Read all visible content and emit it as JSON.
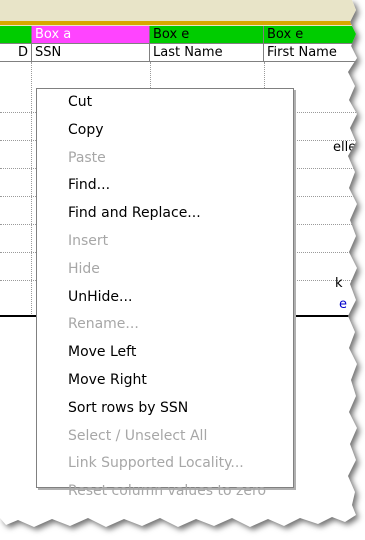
{
  "header": {
    "box_columns": [
      {
        "label": "",
        "color": "#00cc00"
      },
      {
        "label": "Box a",
        "color": "#ff44ff"
      },
      {
        "label": "Box e",
        "color": "#00cc00"
      },
      {
        "label": "Box e",
        "color": "#00cc00"
      }
    ],
    "label_columns": [
      "D",
      "SSN",
      "Last Name",
      "First Name"
    ]
  },
  "grid_peek": {
    "row3_text": "elle",
    "row8_text": "k",
    "row9_text": "e"
  },
  "context_menu": {
    "items": [
      {
        "label": "Cut",
        "enabled": true
      },
      {
        "label": "Copy",
        "enabled": true
      },
      {
        "label": "Paste",
        "enabled": false
      },
      {
        "label": "Find...",
        "enabled": true
      },
      {
        "label": "Find and Replace...",
        "enabled": true
      },
      {
        "label": "Insert",
        "enabled": false
      },
      {
        "label": "Hide",
        "enabled": false
      },
      {
        "label": "UnHide...",
        "enabled": true
      },
      {
        "label": "Rename...",
        "enabled": false
      },
      {
        "label": "Move Left",
        "enabled": true
      },
      {
        "label": "Move Right",
        "enabled": true
      },
      {
        "label": "Sort rows by SSN",
        "enabled": true
      },
      {
        "label": "Select / Unselect All",
        "enabled": false
      },
      {
        "label": "Link Supported Locality...",
        "enabled": false
      },
      {
        "label": "Reset column values to zero",
        "enabled": false
      }
    ]
  }
}
